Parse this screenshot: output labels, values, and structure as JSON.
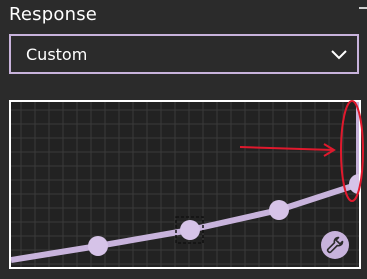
{
  "section": {
    "title": "Response"
  },
  "dropdown": {
    "selected": "Custom",
    "icon": "chevron-down-icon"
  },
  "curve_editor": {
    "curve_color": "#c8b3dc",
    "grid_color": "#3a3a3a",
    "background": "#222222",
    "selected_point_index": 1,
    "tools_icon": "wrench-icon"
  },
  "annotation": {
    "color": "#e0192d"
  }
}
